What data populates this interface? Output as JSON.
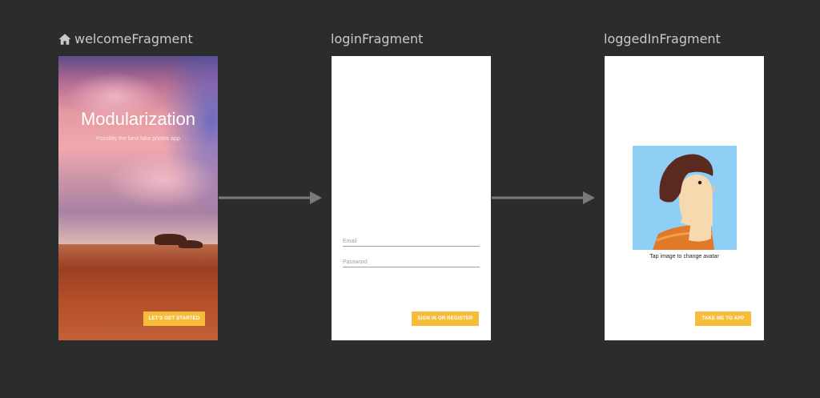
{
  "fragments": {
    "welcome": {
      "title": "welcomeFragment",
      "heading": "Modularization",
      "subtitle": "Possibly the best fake photos app",
      "button_label": "LET'S GET STARTED"
    },
    "login": {
      "title": "loginFragment",
      "email_placeholder": "Email",
      "password_placeholder": "Password",
      "button_label": "SIGN IN OR REGISTER"
    },
    "logged_in": {
      "title": "loggedInFragment",
      "avatar_caption": "Tap image to change avatar",
      "button_label": "TAKE ME TO APP"
    }
  },
  "icons": {
    "start_destination": "home-icon",
    "navigation_action": "arrow-right-icon"
  },
  "colors": {
    "canvas_background": "#2b2c2e",
    "title_text": "#c9c9c9",
    "button_accent": "#f6bd3b",
    "arrow": "#7a7a7a",
    "avatar_background": "#8fcff5"
  }
}
